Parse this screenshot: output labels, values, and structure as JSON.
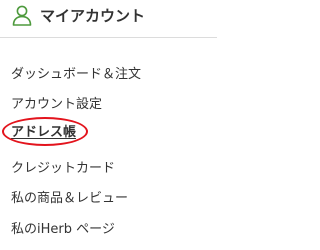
{
  "header": {
    "icon": "user-icon",
    "title": "マイアカウント"
  },
  "menu": {
    "items": [
      {
        "label": "ダッシュボード＆注文",
        "active": false
      },
      {
        "label": "アカウント設定",
        "active": false
      },
      {
        "label": "アドレス帳",
        "active": true
      },
      {
        "label": "クレジットカード",
        "active": false
      },
      {
        "label": "私の商品＆レビュー",
        "active": false
      },
      {
        "label": "私のiHerb ページ",
        "active": false
      }
    ]
  },
  "annotation": {
    "ring_color": "#e3141d"
  },
  "colors": {
    "accent": "#4e9a3d",
    "text": "#333333",
    "divider": "#dcdcdc"
  }
}
